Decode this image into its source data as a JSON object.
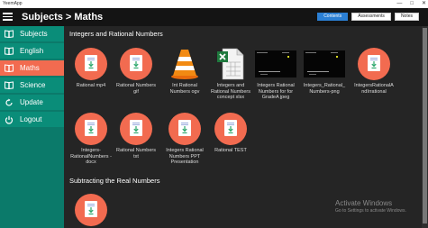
{
  "window": {
    "title": "YeemApp",
    "controls": [
      "—",
      "□",
      "✕"
    ]
  },
  "header": {
    "breadcrumb": "Subjects > Maths",
    "tabs": [
      "Contents",
      "Assessments",
      "Notes"
    ],
    "active_tab": "Contents"
  },
  "sidebar": {
    "items": [
      {
        "label": "Subjects",
        "icon": "book-icon"
      },
      {
        "label": "English",
        "icon": "book-icon"
      },
      {
        "label": "Maths",
        "icon": "book-icon",
        "active": true
      },
      {
        "label": "Science",
        "icon": "book-icon"
      },
      {
        "label": "Update",
        "icon": "refresh-icon"
      },
      {
        "label": "Logout",
        "icon": "power-icon"
      }
    ]
  },
  "sections": [
    {
      "title": "Integers and Rational Numbers",
      "items": [
        {
          "caption": "Rational mp4",
          "icon": "download-icon"
        },
        {
          "caption": "Rational Numbers gif",
          "icon": "download-icon"
        },
        {
          "caption": "Int Rational Numbers ogv",
          "icon": "vlc-icon"
        },
        {
          "caption": "Integers and Rational Numbers concept xlsx",
          "icon": "excel-icon"
        },
        {
          "caption": "Integers Rational Numbers for for GradeA jpeg",
          "icon": "image-thumbnail"
        },
        {
          "caption": "Integers_Rational_ Numbers-png",
          "icon": "image-thumbnail"
        },
        {
          "caption": "IntegersRationalA ndIrrational",
          "icon": "download-icon"
        },
        {
          "caption": "Integers-RationalNumbers -docx",
          "icon": "download-icon"
        },
        {
          "caption": "Rational Numbers txt",
          "icon": "download-icon"
        },
        {
          "caption": "Integers Rational Numbers PPT Presentation",
          "icon": "download-icon"
        },
        {
          "caption": "Rational TEST",
          "icon": "download-icon"
        }
      ]
    },
    {
      "title": "Subtracting the Real Numbers",
      "items": [
        {
          "caption": "",
          "icon": "download-icon"
        }
      ]
    }
  ],
  "watermark": {
    "line1": "Activate Windows",
    "line2": "Go to Settings to activate Windows."
  },
  "colors": {
    "accent": "#f26b50",
    "sidebar": "#0a8d79",
    "tab_active": "#2b7fd4",
    "background": "#252525"
  }
}
